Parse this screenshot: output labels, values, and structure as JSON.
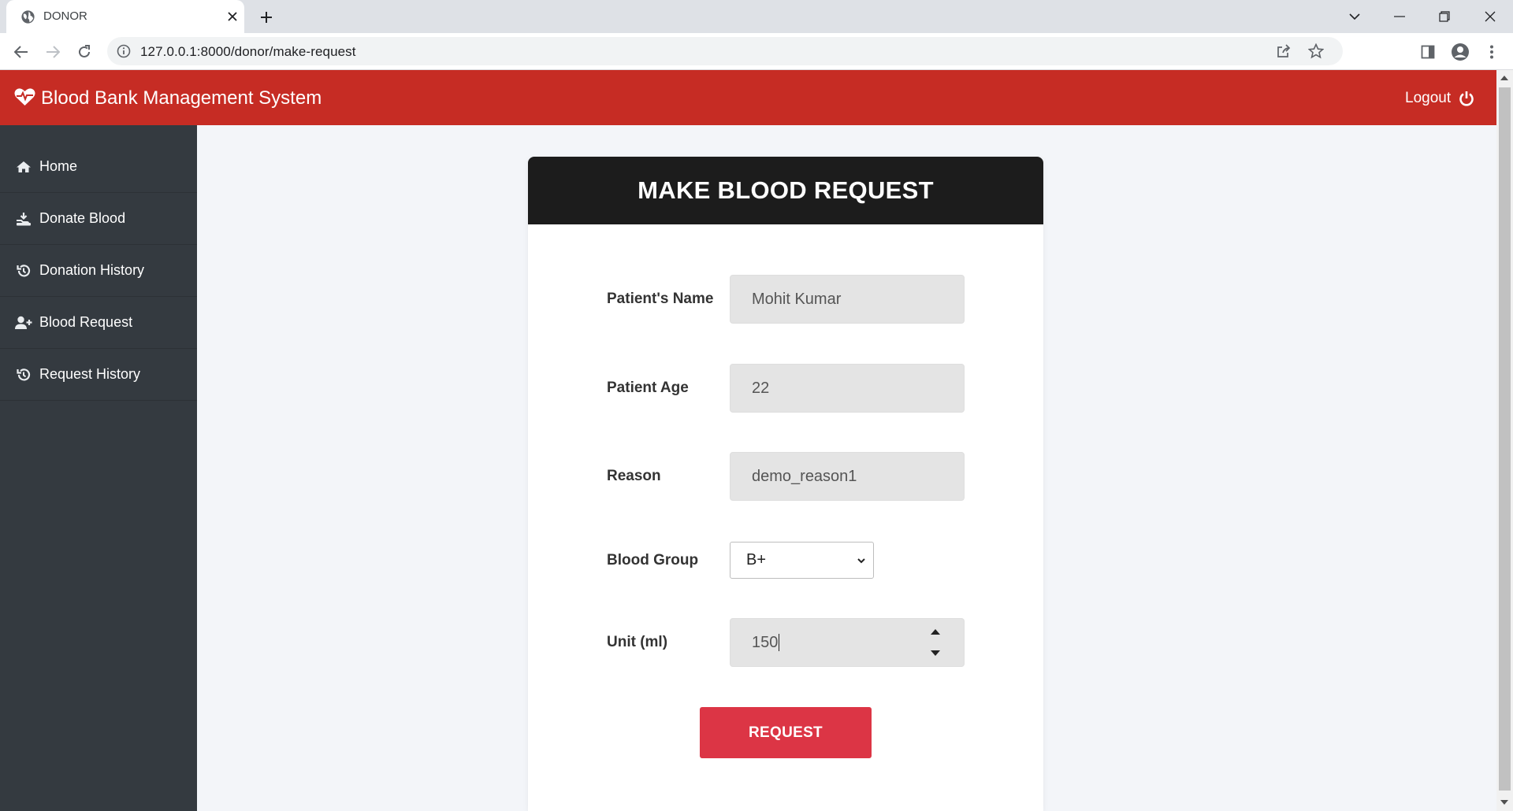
{
  "browser": {
    "tab_title": "DONOR",
    "url": "127.0.0.1:8000/donor/make-request"
  },
  "navbar": {
    "brand": "Blood Bank Management System",
    "logout_label": "Logout",
    "color": "#c62c24"
  },
  "sidebar": {
    "items": [
      {
        "label": "Home",
        "icon": "home-icon"
      },
      {
        "label": "Donate Blood",
        "icon": "donate-icon"
      },
      {
        "label": "Donation History",
        "icon": "history-icon"
      },
      {
        "label": "Blood Request",
        "icon": "user-plus-icon"
      },
      {
        "label": "Request History",
        "icon": "history-icon"
      }
    ]
  },
  "form": {
    "title": "MAKE BLOOD REQUEST",
    "patient_name": {
      "label": "Patient's Name",
      "value": "Mohit Kumar"
    },
    "patient_age": {
      "label": "Patient Age",
      "value": "22"
    },
    "reason": {
      "label": "Reason",
      "value": "demo_reason1"
    },
    "blood_group": {
      "label": "Blood Group",
      "value": "B+"
    },
    "unit": {
      "label": "Unit (ml)",
      "value": "150"
    },
    "submit_label": "REQUEST",
    "submit_color": "#dc3545"
  }
}
